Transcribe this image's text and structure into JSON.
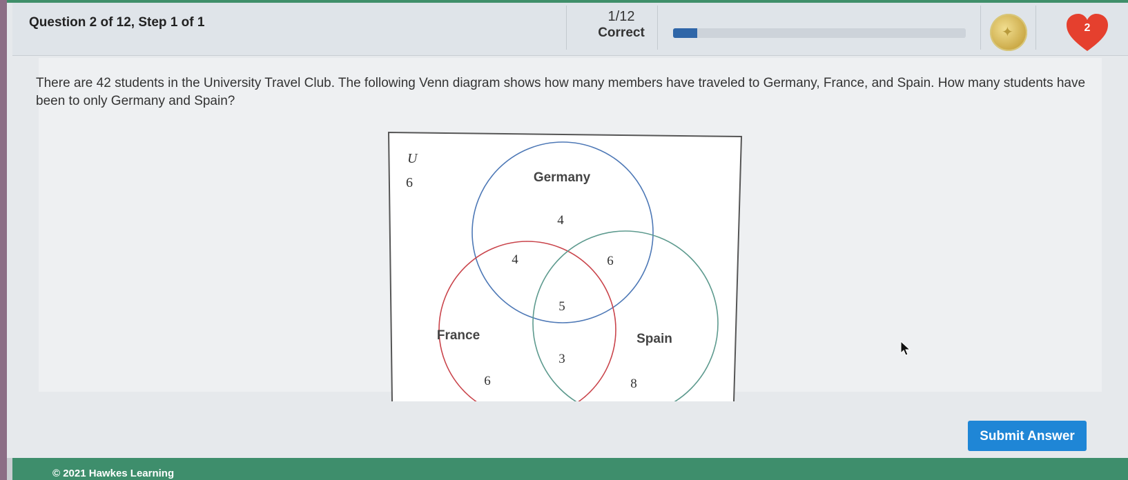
{
  "header": {
    "question_label": "Question 2 of 12, Step 1 of 1",
    "score_fraction": "1/12",
    "score_label": "Correct",
    "progress_fraction": 0.0833,
    "lives": "2"
  },
  "question": {
    "text": "There are 42 students in the University Travel Club. The following Venn diagram shows how many members have traveled to Germany, France, and Spain. How many students have been to only Germany and Spain?"
  },
  "venn": {
    "universe_label": "U",
    "universe_value": "6",
    "sets": {
      "germany": {
        "label": "Germany",
        "color": "#4d78b6"
      },
      "france": {
        "label": "France",
        "color": "#c9434a"
      },
      "spain": {
        "label": "Spain",
        "color": "#5d9a8e"
      }
    },
    "regions": {
      "germany_only": "4",
      "germany_france": "4",
      "germany_spain": "6",
      "all_three": "5",
      "france_spain": "3",
      "france_only": "6",
      "spain_only": "8"
    }
  },
  "actions": {
    "submit_label": "Submit Answer"
  },
  "footer": {
    "copyright": "© 2021 Hawkes Learning"
  },
  "colors": {
    "accent": "#1f86d6",
    "footer_bg": "#3e8e6c",
    "progress": "#2f66a8",
    "heart": "#e5402e"
  }
}
